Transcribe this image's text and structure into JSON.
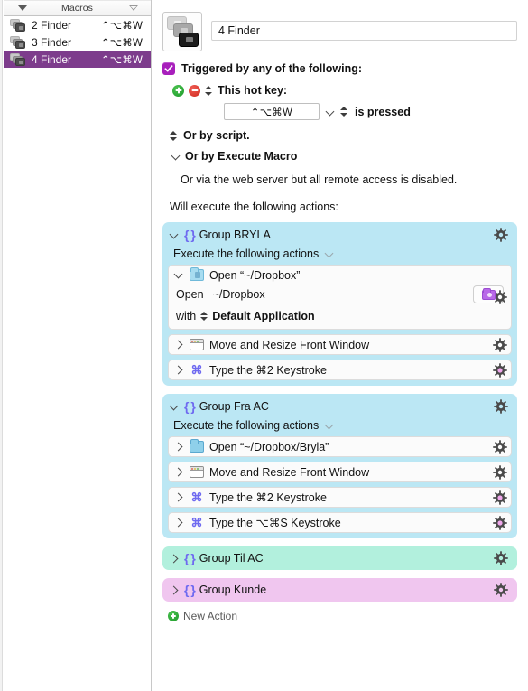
{
  "sidebar": {
    "header_title": "Macros",
    "sort_icon_left": "triangle-down-filled-icon",
    "sort_icon_right": "triangle-down-outline-icon",
    "macros": [
      {
        "name": "2 Finder",
        "hotkey": "⌃⌥⌘W",
        "selected": false
      },
      {
        "name": "3 Finder",
        "hotkey": "⌃⌥⌘W",
        "selected": false
      },
      {
        "name": "4 Finder",
        "hotkey": "⌃⌥⌘W",
        "selected": true
      }
    ]
  },
  "detail": {
    "macro_name": "4 Finder",
    "trigger_checkbox_label": "Triggered by any of the following:",
    "trigger_checkbox_color": "#a81fbc",
    "hotkey_trigger_label": "This hot key:",
    "hotkey_value": "⌃⌥⌘W",
    "hotkey_condition": "is pressed",
    "or_by_script": "Or by script.",
    "or_by_execute_macro": "Or by Execute Macro",
    "web_server_note": "Or via the web server but all remote access is disabled.",
    "will_execute_label": "Will execute the following actions:",
    "new_action_label": "New Action"
  },
  "action_groups": [
    {
      "title": "Group BRYLA",
      "color": "#bbe7f4",
      "theme": "cyan",
      "expanded": true,
      "execute_label": "Execute the following actions",
      "actions": [
        {
          "title": "Open “~/Dropbox”",
          "icon": "folder-icon",
          "expanded": true,
          "gear_accent": "gray",
          "fields": {
            "open_label": "Open",
            "open_value": "~/Dropbox",
            "browse_icon": "folder-purple-icon",
            "with_label": "with",
            "with_value": "Default Application"
          }
        },
        {
          "title": "Move and Resize Front Window",
          "icon": "window-icon",
          "expanded": false,
          "gear_accent": "gray"
        },
        {
          "title": "Type the ⌘2 Keystroke",
          "icon": "command-icon",
          "expanded": false,
          "gear_accent": "pink"
        }
      ]
    },
    {
      "title": "Group Fra AC",
      "color": "#bbe7f4",
      "theme": "cyan",
      "expanded": true,
      "execute_label": "Execute the following actions",
      "actions": [
        {
          "title": "Open “~/Dropbox/Bryla”",
          "icon": "folder-icon",
          "expanded": false,
          "gear_accent": "gray"
        },
        {
          "title": "Move and Resize Front Window",
          "icon": "window-icon",
          "expanded": false,
          "gear_accent": "gray"
        },
        {
          "title": "Type the ⌘2 Keystroke",
          "icon": "command-icon",
          "expanded": false,
          "gear_accent": "pink"
        },
        {
          "title": "Type the ⌥⌘S Keystroke",
          "icon": "command-icon",
          "expanded": false,
          "gear_accent": "pink"
        }
      ]
    },
    {
      "title": "Group Til AC",
      "color": "#b2f0dd",
      "theme": "mint",
      "expanded": false,
      "actions": []
    },
    {
      "title": "Group Kunde",
      "color": "#f0c6ef",
      "theme": "pink",
      "expanded": false,
      "actions": []
    }
  ]
}
